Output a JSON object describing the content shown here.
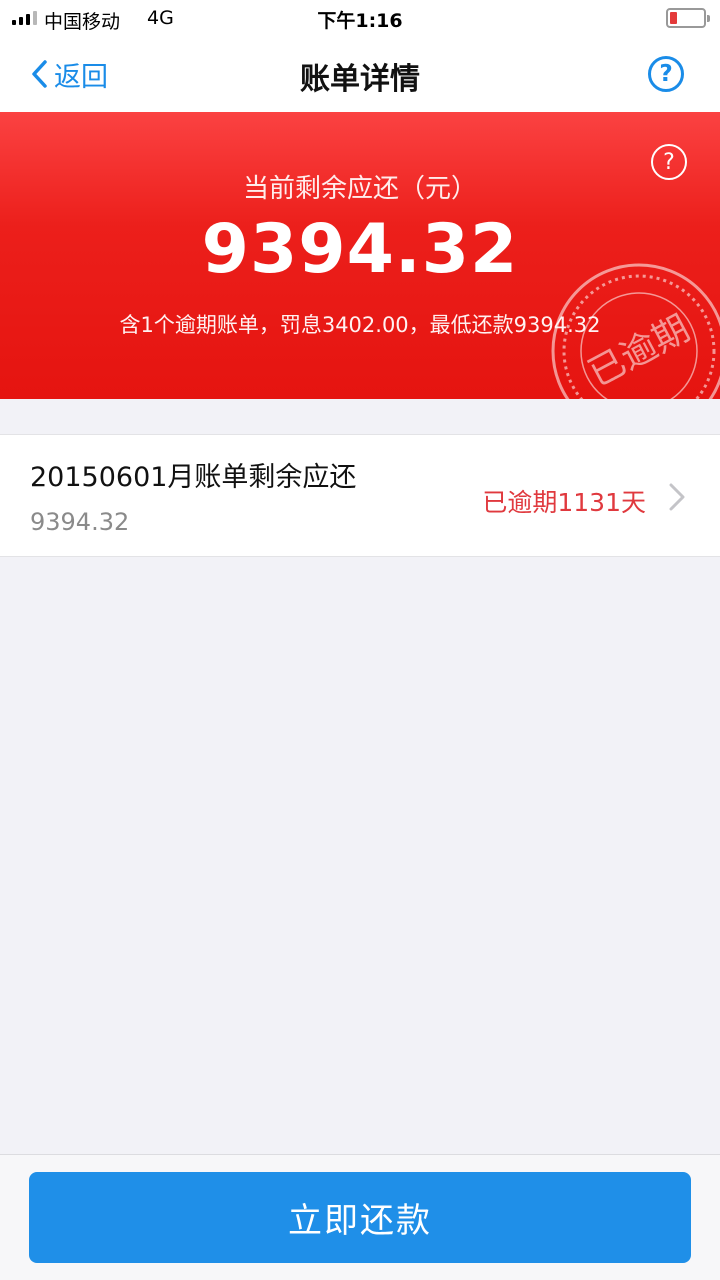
{
  "status_bar": {
    "carrier": "中国移动",
    "network": "4G",
    "time": "下午1:16",
    "battery_icon": "battery-low-icon"
  },
  "nav": {
    "back_label": "返回",
    "title": "账单详情",
    "help_icon": "question-circle-icon"
  },
  "summary": {
    "label": "当前剩余应还（元）",
    "amount": "9394.32",
    "detail": "含1个逾期账单，罚息3402.00，最低还款9394.32",
    "stamp_text": "已逾期",
    "help_icon": "question-circle-icon"
  },
  "bills": [
    {
      "title": "20150601月账单剩余应还",
      "amount": "9394.32",
      "status": "已逾期1131天"
    }
  ],
  "footer": {
    "pay_label": "立即还款"
  },
  "colors": {
    "accent": "#1f8fe8",
    "summary_red": "#e51410",
    "overdue_text": "#e0393e",
    "page_bg": "#f2f2f7"
  }
}
